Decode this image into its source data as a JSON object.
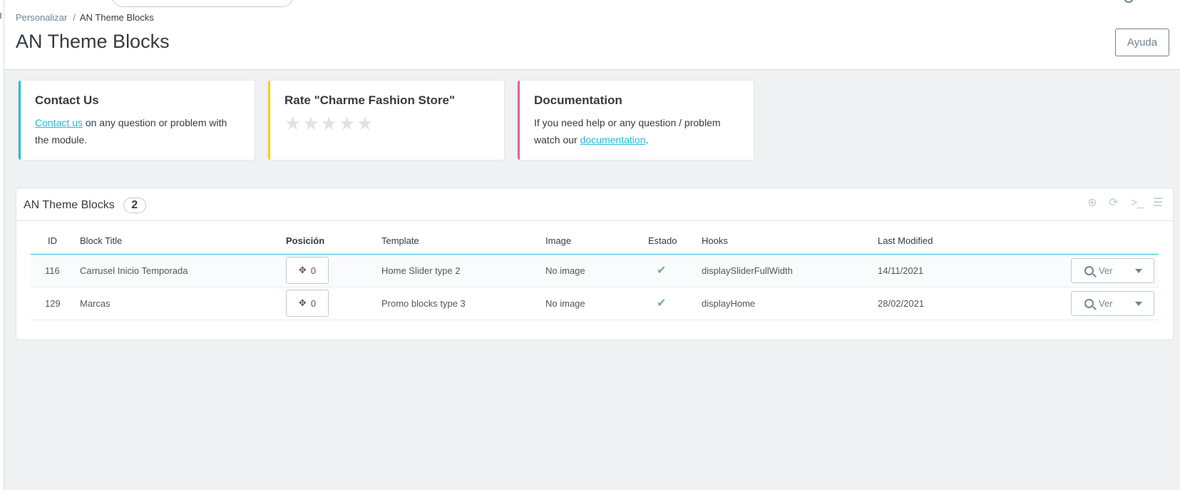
{
  "breadcrumb": {
    "parent": "Personalizar",
    "separator": "/",
    "current": "AN Theme Blocks"
  },
  "page": {
    "title": "AN Theme Blocks",
    "help_label": "Ayuda"
  },
  "cards": {
    "contact": {
      "title": "Contact Us",
      "link": "Contact us",
      "text": " on any question or problem with the module.",
      "accent": "#25b9d7"
    },
    "rate": {
      "title": "Rate \"Charme Fashion Store\"",
      "stars": 5,
      "accent": "#fbcd10"
    },
    "docs": {
      "title": "Documentation",
      "text_before": "If you need help or any question / problem watch our ",
      "link": "documentation",
      "text_after": ".",
      "accent": "#e75f8d"
    }
  },
  "panel": {
    "title": "AN Theme Blocks",
    "count": "2",
    "tools": [
      "add-icon",
      "refresh-icon",
      "sql-icon",
      "database-icon"
    ]
  },
  "table": {
    "headers": {
      "id": "ID",
      "title": "Block Title",
      "position": "Posición",
      "template": "Template",
      "image": "Image",
      "status": "Estado",
      "hooks": "Hooks",
      "modified": "Last Modified"
    },
    "rows": [
      {
        "id": "116",
        "title": "Carrusel Inicio Temporada",
        "position": "0",
        "template": "Home Slider type 2",
        "image": "No image",
        "status": "✔",
        "hooks": "displaySliderFullWidth",
        "modified": "14/11/2021",
        "action": "Ver"
      },
      {
        "id": "129",
        "title": "Marcas",
        "position": "0",
        "template": "Promo blocks type 3",
        "image": "No image",
        "status": "✔",
        "hooks": "displayHome",
        "modified": "28/02/2021",
        "action": "Ver"
      }
    ]
  }
}
